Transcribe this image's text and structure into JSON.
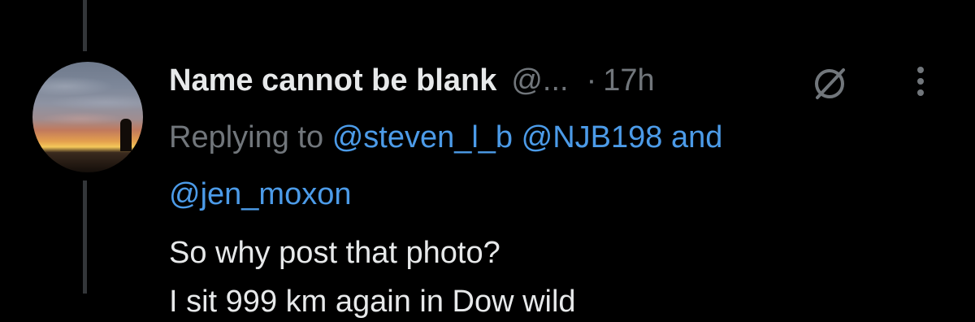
{
  "post": {
    "display_name": "Name cannot be blank",
    "handle": "@...",
    "separator": "·",
    "time": "17h",
    "reply_prefix": "Replying to",
    "mentions": [
      "@steven_l_b",
      "@NJB198"
    ],
    "reply_and": "and",
    "mention_last": "@jen_moxon",
    "text": "So why post that photo?",
    "text_cutoff": "I sit 999 km again in Dow wild"
  },
  "colors": {
    "background": "#000000",
    "primary_text": "#e7e9ea",
    "secondary_text": "#71767b",
    "link": "#4c9be8",
    "thread_line": "#333639"
  },
  "icons": {
    "grok": "grok-slash-icon",
    "more": "more-vertical-icon"
  }
}
